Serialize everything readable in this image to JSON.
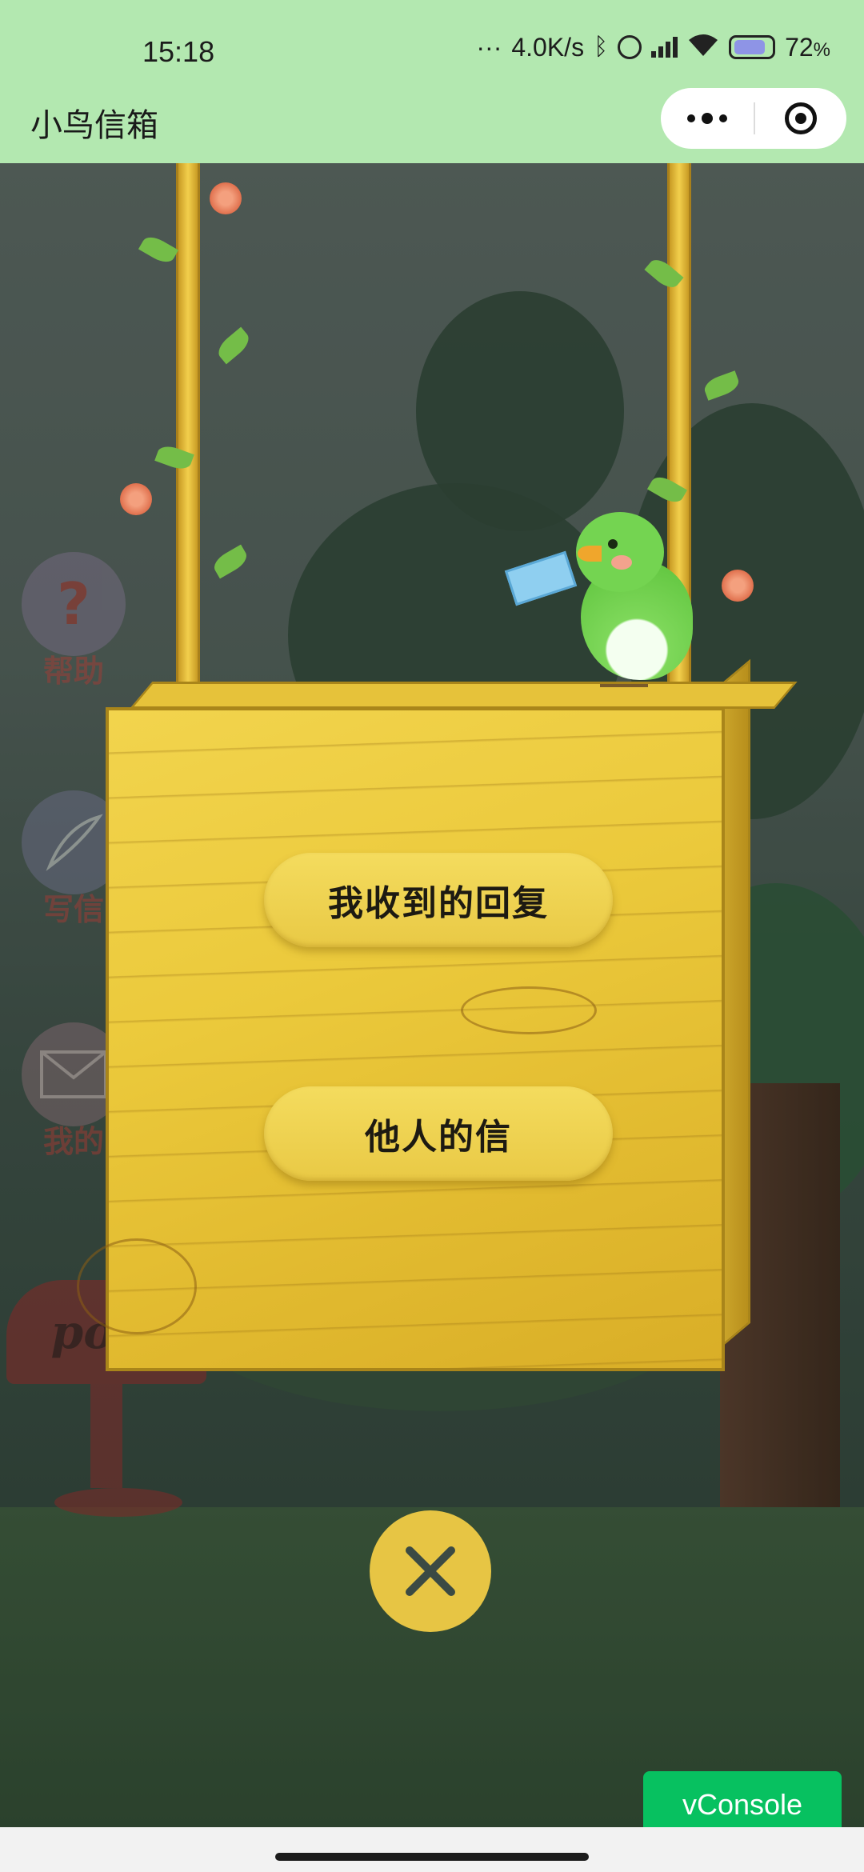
{
  "status_bar": {
    "time": "15:18",
    "dots": "···",
    "speed": "4.0K/s",
    "battery_pct": "72",
    "battery_unit": "%",
    "icons": [
      "bluetooth-icon",
      "alarm-icon",
      "signal-icon",
      "wifi-icon",
      "battery-icon"
    ]
  },
  "header": {
    "title": "小鸟信箱",
    "capsule_icons": [
      "more-icon",
      "close-miniprogram-icon"
    ]
  },
  "side_menu": {
    "items": [
      {
        "label": "帮助",
        "glyph": "?"
      },
      {
        "label": "写信"
      },
      {
        "label": "我的"
      }
    ]
  },
  "post_box": {
    "text": "post"
  },
  "sign": {
    "buttons": [
      {
        "label": "我收到的回复"
      },
      {
        "label": "他人的信"
      }
    ]
  },
  "close_button": {
    "icon": "close-icon",
    "color": "#e7c544"
  },
  "vconsole": {
    "label": "vConsole",
    "color": "#07c160"
  },
  "theme": {
    "header_bg": "#b3e8b0",
    "board": "#ebc93b"
  }
}
